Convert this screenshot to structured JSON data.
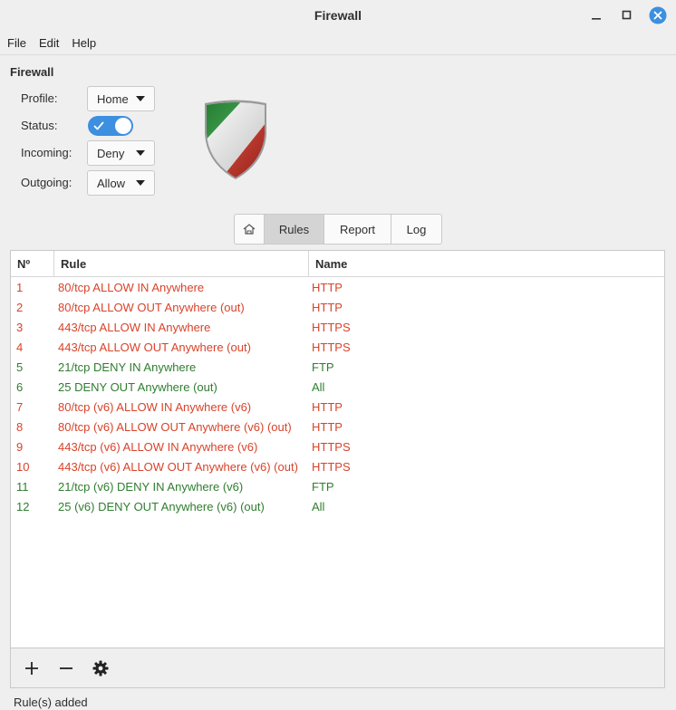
{
  "window": {
    "title": "Firewall"
  },
  "menu": [
    "File",
    "Edit",
    "Help"
  ],
  "section_title": "Firewall",
  "form": {
    "profile_label": "Profile:",
    "profile_value": "Home",
    "status_label": "Status:",
    "status_on": true,
    "incoming_label": "Incoming:",
    "incoming_value": "Deny",
    "outgoing_label": "Outgoing:",
    "outgoing_value": "Allow"
  },
  "tabs": {
    "rules": "Rules",
    "report": "Report",
    "log": "Log",
    "active": "rules"
  },
  "table": {
    "headers": {
      "no": "Nº",
      "rule": "Rule",
      "name": "Name"
    },
    "rows": [
      {
        "no": "1",
        "rule": "80/tcp ALLOW IN Anywhere",
        "name": "HTTP",
        "action": "allow"
      },
      {
        "no": "2",
        "rule": "80/tcp ALLOW OUT Anywhere (out)",
        "name": "HTTP",
        "action": "allow"
      },
      {
        "no": "3",
        "rule": "443/tcp ALLOW IN Anywhere",
        "name": "HTTPS",
        "action": "allow"
      },
      {
        "no": "4",
        "rule": "443/tcp ALLOW OUT Anywhere (out)",
        "name": "HTTPS",
        "action": "allow"
      },
      {
        "no": "5",
        "rule": "21/tcp DENY IN Anywhere",
        "name": "FTP",
        "action": "deny"
      },
      {
        "no": "6",
        "rule": "25 DENY OUT Anywhere (out)",
        "name": "All",
        "action": "deny"
      },
      {
        "no": "7",
        "rule": "80/tcp (v6) ALLOW IN Anywhere (v6)",
        "name": "HTTP",
        "action": "allow"
      },
      {
        "no": "8",
        "rule": "80/tcp (v6) ALLOW OUT Anywhere (v6) (out)",
        "name": "HTTP",
        "action": "allow"
      },
      {
        "no": "9",
        "rule": "443/tcp (v6) ALLOW IN Anywhere (v6)",
        "name": "HTTPS",
        "action": "allow"
      },
      {
        "no": "10",
        "rule": "443/tcp (v6) ALLOW OUT Anywhere (v6) (out)",
        "name": "HTTPS",
        "action": "allow"
      },
      {
        "no": "11",
        "rule": "21/tcp (v6) DENY IN Anywhere (v6)",
        "name": "FTP",
        "action": "deny"
      },
      {
        "no": "12",
        "rule": "25 (v6) DENY OUT Anywhere (v6) (out)",
        "name": "All",
        "action": "deny"
      }
    ]
  },
  "toolbar_icons": [
    "add-icon",
    "remove-icon",
    "gear-icon"
  ],
  "status_text": "Rule(s) added",
  "colors": {
    "allow": "#d8432a",
    "deny": "#2f7d2f",
    "toggle_on": "#3d8fe0"
  }
}
